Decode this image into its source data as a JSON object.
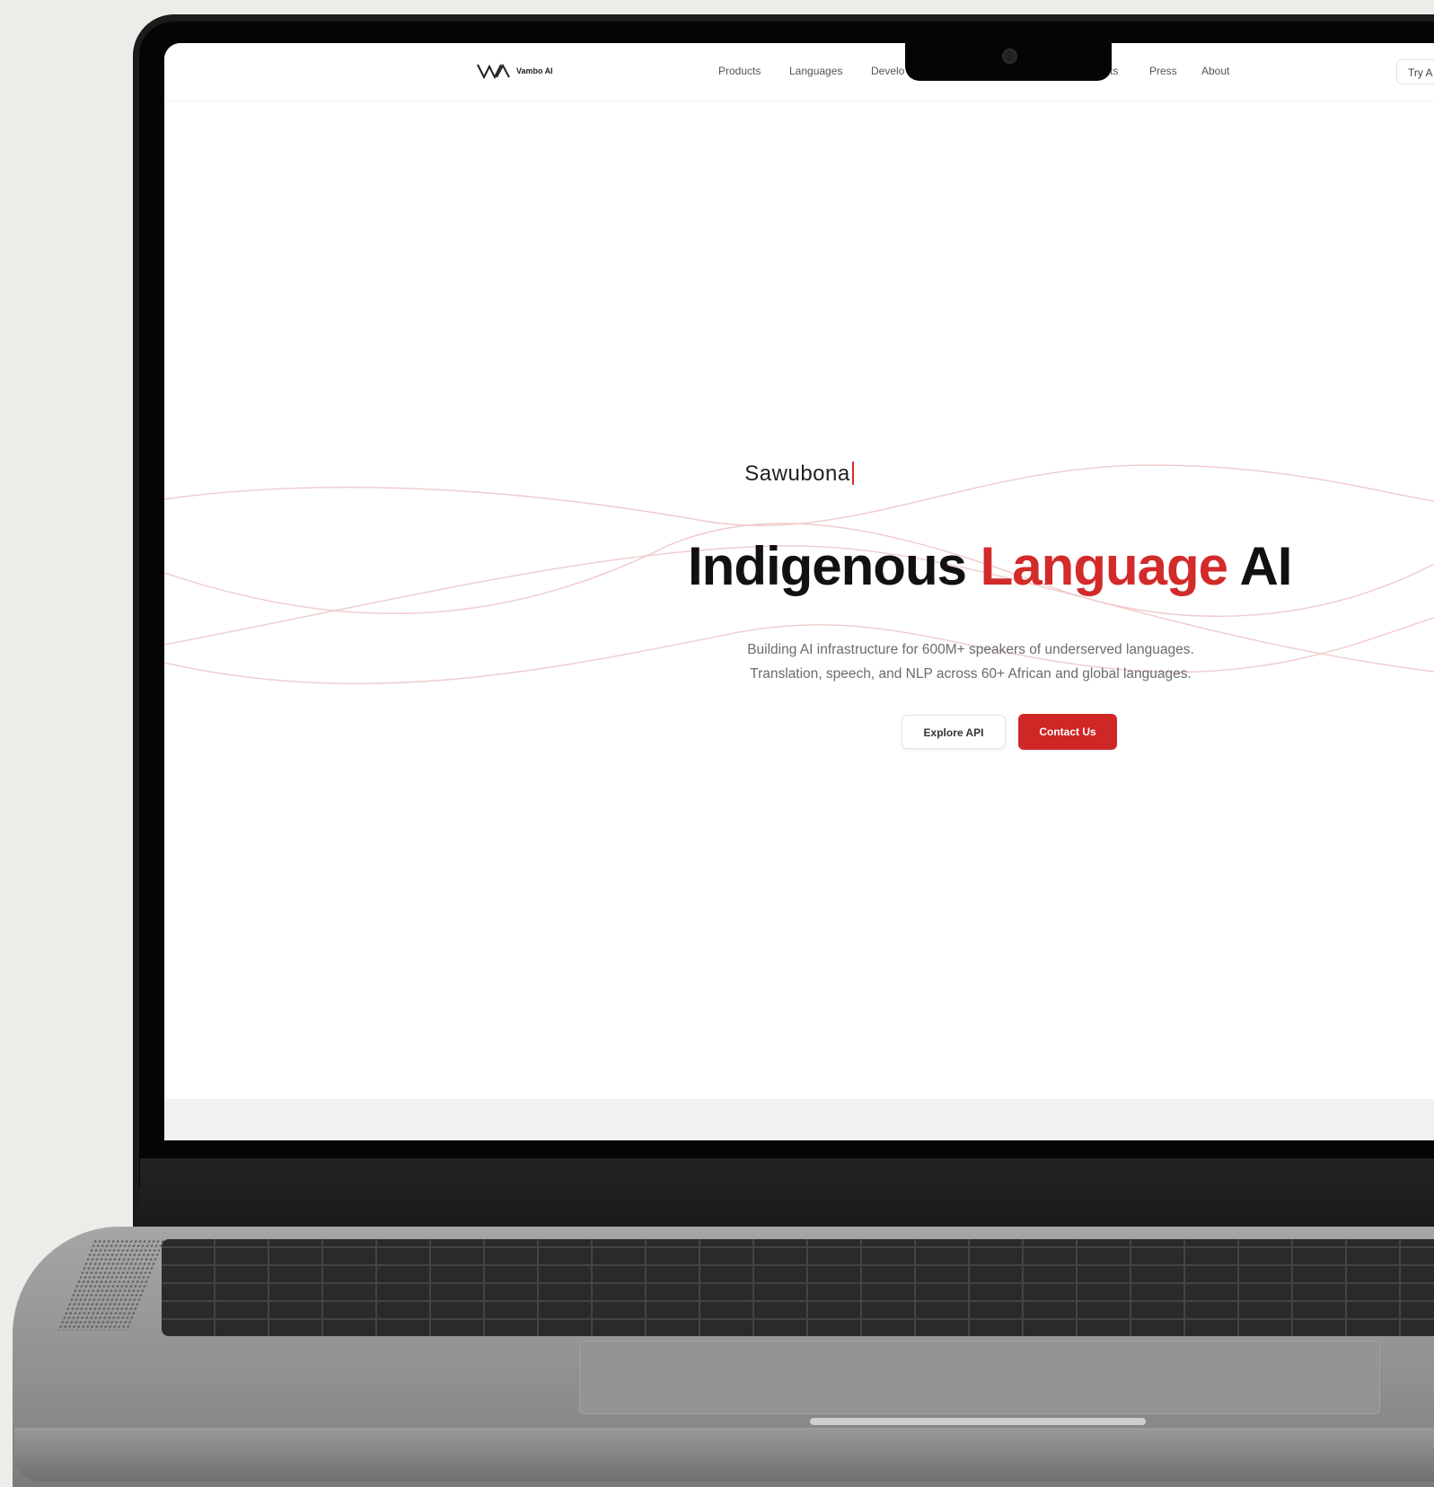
{
  "nav": {
    "brand": "Vambo AI",
    "links": [
      "Products",
      "Languages",
      "Develo",
      "ts",
      "Press",
      "About"
    ],
    "cta": "Try A"
  },
  "hero": {
    "greeting": "Sawubona",
    "title_part1": "Indigenous",
    "title_part2": "Language",
    "title_part3": "AI",
    "subtitle_line1": "Building AI infrastructure for 600M+ speakers of underserved languages.",
    "subtitle_line2": "Translation, speech, and NLP across 60+ African and global languages.",
    "primary_button": "Contact Us",
    "secondary_button": "Explore API"
  },
  "colors": {
    "accent": "#cf2626",
    "text": "#111111",
    "background": "#ffffff"
  }
}
